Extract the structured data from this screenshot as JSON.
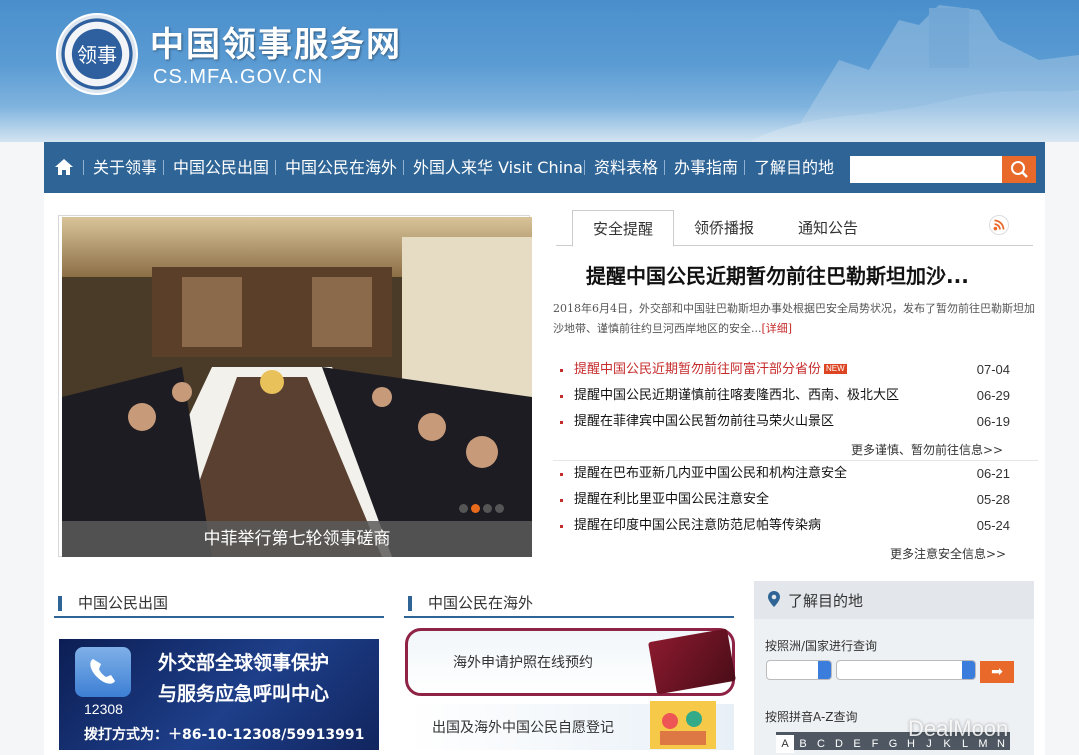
{
  "header": {
    "site_title": "中国领事服务网",
    "site_url": "CS.MFA.GOV.CN",
    "logo_text": "领事"
  },
  "nav": {
    "items": [
      "关于领事",
      "中国公民出国",
      "中国公民在海外",
      "外国人来华 Visit China",
      "资料表格",
      "办事指南",
      "了解目的地"
    ],
    "search_placeholder": ""
  },
  "slideshow": {
    "caption": "中菲举行第七轮领事磋商",
    "slide_count": 4,
    "active_index": 1
  },
  "news": {
    "tabs": [
      "安全提醒",
      "领侨播报",
      "通知公告"
    ],
    "headline": "提醒中国公民近期暂勿前往巴勒斯坦加沙...",
    "summary": "2018年6月4日，外交部和中国驻巴勒斯坦办事处根据巴安全局势状况，发布了暂勿前往巴勒斯坦加沙地带、谨慎前往约旦河西岸地区的安全...",
    "detail_link": "[详细]",
    "new_tag": "NEW",
    "list1": [
      {
        "title": "提醒中国公民近期暂勿前往阿富汗部分省份",
        "date": "07-04",
        "highlight": true
      },
      {
        "title": "提醒中国公民近期谨慎前往喀麦隆西北、西南、极北大区",
        "date": "06-29",
        "highlight": false
      },
      {
        "title": "提醒在菲律宾中国公民暂勿前往马荣火山景区",
        "date": "06-19",
        "highlight": false
      }
    ],
    "more1": "更多谨慎、暂勿前往信息>>",
    "list2": [
      {
        "title": "提醒在巴布亚新几内亚中国公民和机构注意安全",
        "date": "06-21"
      },
      {
        "title": "提醒在利比里亚中国公民注意安全",
        "date": "05-28"
      },
      {
        "title": "提醒在印度中国公民注意防范尼帕等传染病",
        "date": "05-24"
      }
    ],
    "more2": "更多注意安全信息>>"
  },
  "sections": {
    "going_abroad": {
      "title": "中国公民出国",
      "banner_line1": "外交部全球领事保护",
      "banner_line2": "与服务应急呼叫中心",
      "banner_number": "12308",
      "banner_phone": "拨打方式为：＋86-10-12308/59913991"
    },
    "overseas": {
      "title": "中国公民在海外",
      "banner_passport": "海外申请护照在线预约",
      "banner_register": "出国及海外中国公民自愿登记"
    }
  },
  "destination": {
    "title": "了解目的地",
    "by_region_label": "按照洲/国家进行查询",
    "go_button": "➡",
    "by_pinyin_label": "按照拼音A-Z查询",
    "letters": [
      "A",
      "B",
      "C",
      "D",
      "E",
      "F",
      "G",
      "H",
      "J",
      "K",
      "L",
      "M",
      "N"
    ]
  },
  "watermark": "DealMoon",
  "colors": {
    "nav_bg": "#2f6596",
    "accent_orange": "#e8692a",
    "alert_red": "#c62b2b",
    "banner_border": "#8e2346"
  }
}
